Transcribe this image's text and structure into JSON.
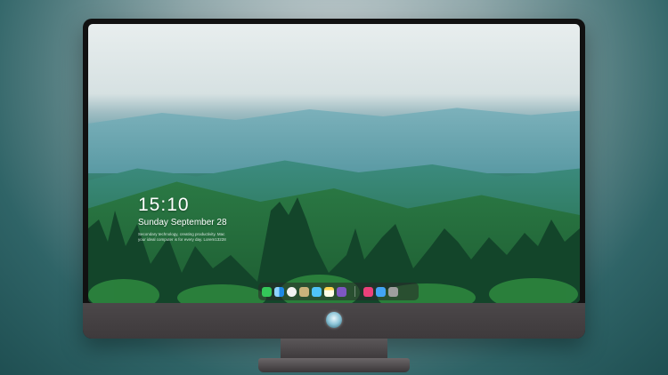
{
  "lock_screen": {
    "time": "15:10",
    "date": "Sunday September 28",
    "notice_line1": "Secondary technology, creating productivity. Mac",
    "notice_line2": "your ideal computer is for every day. Lorem13228"
  },
  "dock": {
    "apps": [
      {
        "name": "messages-icon",
        "color": "#34c759"
      },
      {
        "name": "finder-icon",
        "color": "#1e88e5"
      },
      {
        "name": "safari-icon",
        "color": "#f2f2f2"
      },
      {
        "name": "preview-icon",
        "color": "#c9b27b"
      },
      {
        "name": "claquette-icon",
        "color": "#4fc3f7"
      },
      {
        "name": "notes-icon",
        "color": "#ffd54f"
      },
      {
        "name": "photos-icon",
        "color": "#7e57c2"
      },
      {
        "name": "itunes-icon",
        "color": "#ec407a"
      },
      {
        "name": "appstore-icon",
        "color": "#42a5f5"
      },
      {
        "name": "camera-icon",
        "color": "#9e9e9e"
      }
    ]
  }
}
